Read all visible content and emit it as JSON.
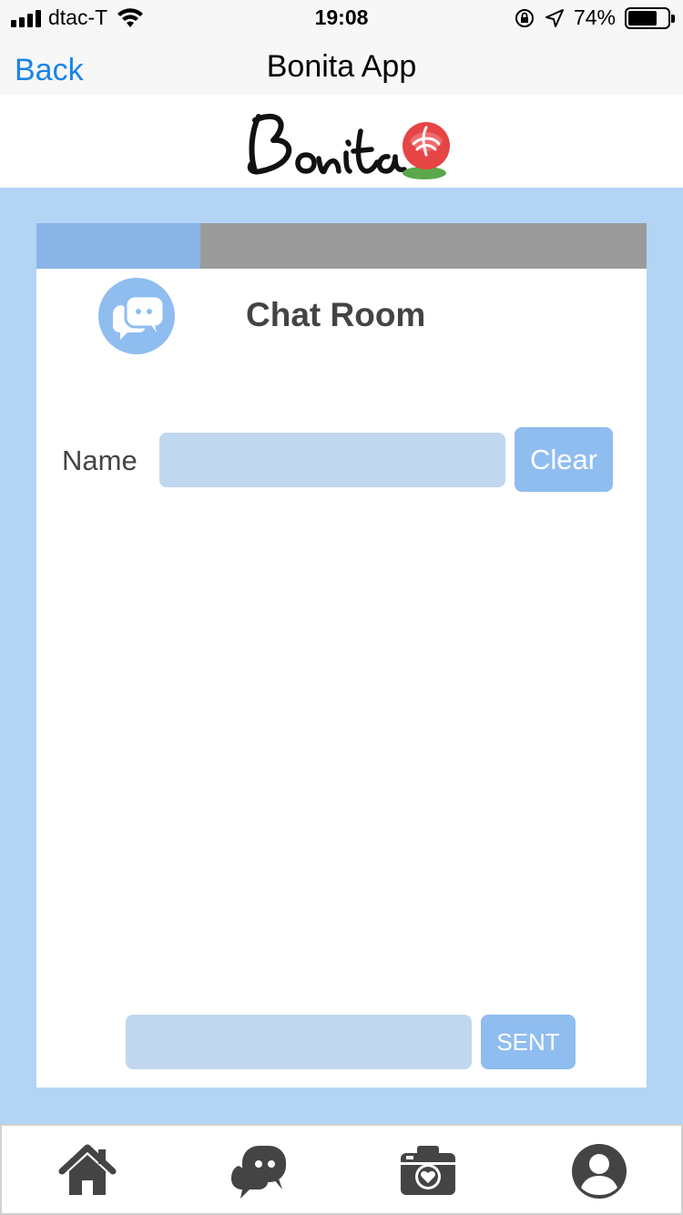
{
  "status_bar": {
    "carrier": "dtac-T",
    "time": "19:08",
    "battery_percent": "74%",
    "battery_level": 0.74,
    "icons": [
      "signal-icon",
      "wifi-icon",
      "orientation-lock-icon",
      "location-icon",
      "battery-icon"
    ]
  },
  "nav": {
    "back_label": "Back",
    "title": "Bonita App"
  },
  "logo": {
    "text": "Bonita",
    "icon": "rose-icon"
  },
  "colors": {
    "accent_blue": "#8fbdf0",
    "background_blue": "#b3d4f5",
    "input_blue": "#c0d7ef",
    "ios_link": "#1a84e8",
    "tab_gray": "#9b9b9b",
    "text_dark": "#444444"
  },
  "chat": {
    "title": "Chat Room",
    "badge_icon": "chat-bubbles-icon",
    "name_label": "Name",
    "name_value": "",
    "name_placeholder": "",
    "clear_label": "Clear",
    "message_value": "",
    "message_placeholder": "",
    "send_label": "SENT"
  },
  "bottom_nav": {
    "items": [
      {
        "name": "home",
        "icon": "home-icon"
      },
      {
        "name": "chat",
        "icon": "chat-bubbles-icon"
      },
      {
        "name": "camera",
        "icon": "camera-heart-icon"
      },
      {
        "name": "profile",
        "icon": "user-circle-icon"
      }
    ]
  }
}
